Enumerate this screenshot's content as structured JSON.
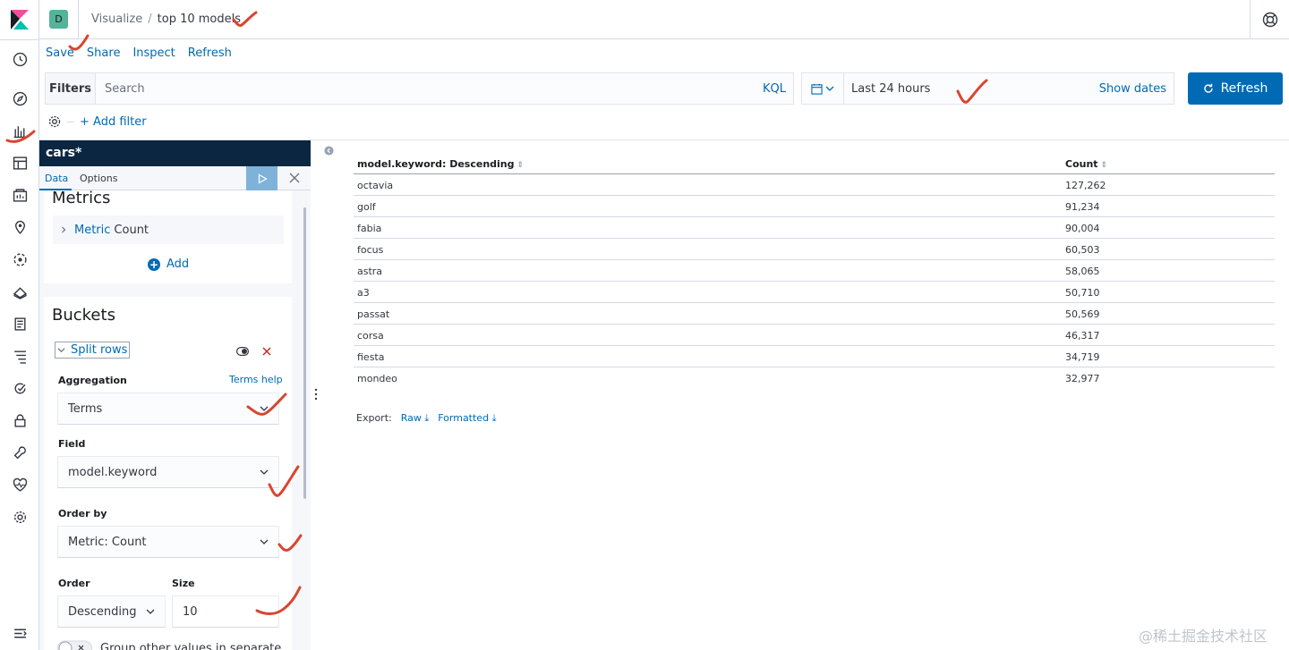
{
  "header": {
    "space_initial": "D",
    "breadcrumbs": [
      "Visualize",
      "top 10 models"
    ],
    "breadcrumb_separator": "/"
  },
  "top_menu": [
    "Save",
    "Share",
    "Inspect",
    "Refresh"
  ],
  "query_bar": {
    "filters_label": "Filters",
    "search_placeholder": "Search",
    "language": "KQL",
    "time_range": "Last 24 hours",
    "show_dates": "Show dates",
    "refresh_label": "Refresh"
  },
  "filter_bar": {
    "add_filter": "+ Add filter"
  },
  "sidebar": {
    "index_pattern": "cars*",
    "tabs": [
      "Data",
      "Options"
    ],
    "metrics": {
      "title": "Metrics",
      "item_label": "Metric",
      "item_value": "Count",
      "add_label": "Add"
    },
    "buckets": {
      "title": "Buckets",
      "split_label": "Split rows",
      "aggregation_label": "Aggregation",
      "aggregation_help": "Terms help",
      "aggregation_value": "Terms",
      "field_label": "Field",
      "field_value": "model.keyword",
      "order_by_label": "Order by",
      "order_by_value": "Metric: Count",
      "order_label": "Order",
      "order_value": "Descending",
      "size_label": "Size",
      "size_value": "10",
      "group_other_label": "Group other values in separate"
    }
  },
  "table": {
    "columns": [
      "model.keyword: Descending",
      "Count"
    ],
    "rows": [
      [
        "octavia",
        "127,262"
      ],
      [
        "golf",
        "91,234"
      ],
      [
        "fabia",
        "90,004"
      ],
      [
        "focus",
        "60,503"
      ],
      [
        "astra",
        "58,065"
      ],
      [
        "a3",
        "50,710"
      ],
      [
        "passat",
        "50,569"
      ],
      [
        "corsa",
        "46,317"
      ],
      [
        "fiesta",
        "34,719"
      ],
      [
        "mondeo",
        "32,977"
      ]
    ]
  },
  "export": {
    "label": "Export:",
    "raw": "Raw",
    "formatted": "Formatted"
  },
  "watermark": "@稀土掘金技术社区",
  "colors": {
    "accent": "#006bb4",
    "sidebar_title_bg": "#0b2641",
    "annotation": "#d9452f"
  }
}
